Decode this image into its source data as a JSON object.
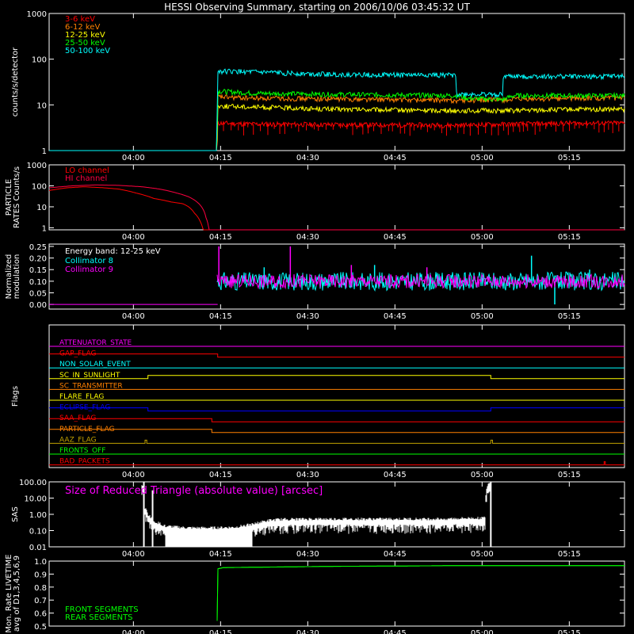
{
  "title": "HESSI Observing Summary, starting on 2006/10/06 03:45:32 UT",
  "time_axis": {
    "start_min": 0,
    "end_min": 99,
    "tick_labels": [
      "04:00",
      "04:15",
      "04:30",
      "04:45",
      "05:00",
      "05:15"
    ],
    "tick_positions_min": [
      14.5,
      29.5,
      44.5,
      59.5,
      74.5,
      89.5
    ]
  },
  "colors": {
    "red": "#ff0000",
    "orange": "#ff8000",
    "yellow": "#ffff00",
    "green": "#00ff00",
    "cyan": "#00ffff",
    "magenta": "#ff00ff",
    "crimson": "#ff0040",
    "blue": "#0000ff",
    "olive": "#c0a000",
    "white": "#ffffff"
  },
  "chart_data": [
    {
      "id": "count-rates",
      "type": "line",
      "ylabel": "counts/s/detector",
      "yscale": "log",
      "ylim": [
        1,
        1000
      ],
      "yticks": [
        "1",
        "10",
        "100",
        "1000"
      ],
      "legend_placement": "top-left",
      "x_units": "minutes after 03:45:32 UT",
      "series": [
        {
          "name": "3-6 keV",
          "color": "red",
          "x": [
            0,
            28.9,
            29,
            35,
            50,
            70,
            80,
            90,
            99
          ],
          "y": [
            1,
            1,
            4,
            3.8,
            3.7,
            3.6,
            3.8,
            4.0,
            4.0
          ]
        },
        {
          "name": "6-12 keV",
          "color": "orange",
          "x": [
            0,
            28.9,
            29,
            35,
            50,
            70,
            80,
            90,
            99
          ],
          "y": [
            1,
            1,
            15,
            14,
            13.5,
            12.5,
            13,
            14,
            14
          ]
        },
        {
          "name": "12-25 keV",
          "color": "yellow",
          "x": [
            0,
            28.9,
            29,
            35,
            50,
            70,
            80,
            90,
            99
          ],
          "y": [
            1,
            1,
            9.5,
            9,
            8,
            7.5,
            7.5,
            8,
            8
          ]
        },
        {
          "name": "25-50 keV",
          "color": "green",
          "x": [
            0,
            28.9,
            29,
            35,
            50,
            70,
            72,
            78,
            80,
            90,
            99
          ],
          "y": [
            1,
            1,
            20,
            18,
            17,
            16,
            14,
            13,
            16,
            16,
            16
          ]
        },
        {
          "name": "50-100 keV",
          "color": "cyan",
          "x": [
            0,
            28.9,
            29,
            40,
            50,
            70,
            70.1,
            78,
            78.1,
            90,
            99
          ],
          "y": [
            1,
            1,
            55,
            50,
            46,
            45,
            17,
            17,
            42,
            42,
            42
          ]
        }
      ]
    },
    {
      "id": "particle-rates",
      "type": "line",
      "ylabel": "PARTICLE RATES Counts/s",
      "yscale": "log",
      "ylim": [
        0.8,
        1000
      ],
      "yticks": [
        "1",
        "10",
        "100",
        "1000"
      ],
      "legend_placement": "top-left",
      "x_units": "minutes after 03:45:32 UT",
      "series": [
        {
          "name": "LO channel",
          "color": "red",
          "x": [
            0,
            3,
            6,
            9,
            12,
            15,
            18,
            21,
            23,
            24,
            25,
            26,
            26.5,
            99
          ],
          "y": [
            60,
            80,
            90,
            82,
            70,
            45,
            25,
            17,
            14,
            10,
            5,
            2,
            0.8,
            0.8
          ]
        },
        {
          "name": "HI channel",
          "color": "crimson",
          "x": [
            0,
            4,
            8,
            12,
            16,
            19,
            22,
            24,
            26,
            27,
            27.5,
            99
          ],
          "y": [
            80,
            100,
            110,
            105,
            90,
            70,
            45,
            30,
            12,
            3,
            0.8,
            0.8
          ]
        }
      ]
    },
    {
      "id": "modulation",
      "type": "line",
      "ylabel": "Normalized modulation",
      "annotation": "Energy band: 12-25 keV",
      "ylim": [
        -0.02,
        0.26
      ],
      "yticks": [
        "0.00",
        "0.05",
        "0.10",
        "0.15",
        "0.20",
        "0.25"
      ],
      "legend_placement": "top-left",
      "x_units": "minutes after 03:45:32 UT",
      "series": [
        {
          "name": "Collimator 8",
          "color": "cyan",
          "x_start": 29,
          "x_end": 99,
          "mean": 0.1,
          "spread": 0.04,
          "spikes": [
            [
              37,
              0.16
            ],
            [
              56,
              0.17
            ],
            [
              83,
              0.21
            ],
            [
              87,
              0.0
            ],
            [
              93,
              0.15
            ]
          ]
        },
        {
          "name": "Collimator 9",
          "color": "magenta",
          "x_start": 29,
          "x_end": 99,
          "mean": 0.1,
          "spread": 0.03,
          "spikes": [
            [
              29.2,
              0.25
            ],
            [
              41.5,
              0.25
            ],
            [
              52,
              0.17
            ],
            [
              65,
              0.16
            ]
          ]
        }
      ]
    },
    {
      "id": "flags",
      "type": "line",
      "ylabel": "Flags",
      "x_units": "minutes after 03:45:32 UT",
      "flags": [
        {
          "name": "ATTENUATOR_STATE",
          "color": "magenta",
          "x": [
            0,
            99
          ],
          "y": [
            0,
            0
          ]
        },
        {
          "name": "GAP_FLAG",
          "color": "red",
          "x": [
            0,
            29,
            29,
            99
          ],
          "y": [
            1,
            1,
            0,
            0
          ]
        },
        {
          "name": "NON_SOLAR_EVENT",
          "color": "cyan",
          "x": [
            0,
            99
          ],
          "y": [
            0,
            0
          ]
        },
        {
          "name": "SC_IN_SUNLIGHT",
          "color": "yellow",
          "x": [
            0,
            17,
            17,
            76,
            76,
            99
          ],
          "y": [
            0,
            0,
            1,
            1,
            0,
            0
          ]
        },
        {
          "name": "SC_TRANSMITTER",
          "color": "orange",
          "x": [
            0,
            99
          ],
          "y": [
            0,
            0
          ]
        },
        {
          "name": "FLARE_FLAG",
          "color": "yellow",
          "x": [
            0,
            99
          ],
          "y": [
            0,
            0
          ]
        },
        {
          "name": "ECLIPSE_FLAG",
          "color": "blue",
          "x": [
            0,
            17,
            17,
            76,
            76,
            99
          ],
          "y": [
            1,
            1,
            0,
            0,
            1,
            1
          ]
        },
        {
          "name": "SAA_FLAG",
          "color": "red",
          "x": [
            0,
            28,
            28,
            99
          ],
          "y": [
            1,
            1,
            0,
            0
          ]
        },
        {
          "name": "PARTICLE_FLAG",
          "color": "orange",
          "x": [
            0,
            28,
            28,
            99
          ],
          "y": [
            1,
            1,
            0,
            0
          ]
        },
        {
          "name": "AAZ_FLAG",
          "color": "olive",
          "x": [
            0,
            16.5,
            16.5,
            16.8,
            16.8,
            76,
            76,
            76.3,
            76.3,
            99
          ],
          "y": [
            0,
            0,
            1,
            1,
            0,
            0,
            1,
            1,
            0,
            0
          ]
        },
        {
          "name": "FRONTS_OFF",
          "color": "green",
          "x": [
            0,
            99
          ],
          "y": [
            0,
            0
          ]
        },
        {
          "name": "BAD_PACKETS",
          "color": "red",
          "x": [
            0,
            95.5,
            95.5,
            95.7,
            95.7,
            99
          ],
          "y": [
            0,
            0,
            1,
            1,
            0,
            0
          ]
        }
      ]
    },
    {
      "id": "sas",
      "type": "line",
      "ylabel": "SAS",
      "annotation": "Size of Reduced Triangle (absolute value) [arcsec]",
      "yscale": "log",
      "ylim": [
        0.01,
        100
      ],
      "yticks": [
        "0.01",
        "0.10",
        "1.00",
        "10.00",
        "100.00"
      ],
      "x_units": "minutes after 03:45:32 UT",
      "series": [
        {
          "name": "",
          "color": "white",
          "x": [
            16,
            16.5,
            17,
            18,
            20,
            24,
            28,
            32,
            35,
            38,
            40,
            45,
            55,
            65,
            70,
            75,
            76,
            76.2
          ],
          "y": [
            60,
            2,
            0.8,
            0.3,
            0.15,
            0.12,
            0.12,
            0.13,
            0.2,
            0.35,
            0.4,
            0.42,
            0.42,
            0.42,
            0.45,
            0.5,
            100,
            0.01
          ],
          "spread": 0.5
        }
      ]
    },
    {
      "id": "livetime",
      "type": "line",
      "ylabel": "Mon. Rate LIVETIME avg of D1,3,4,5,6,9",
      "ylim": [
        0.5,
        1.0
      ],
      "yticks": [
        "0.5",
        "0.6",
        "0.7",
        "0.8",
        "0.9",
        "1.0"
      ],
      "legend_placement": "bottom-left",
      "x_units": "minutes after 03:45:32 UT",
      "series": [
        {
          "name": "FRONT SEGMENTS",
          "color": "green",
          "x": [
            28.9,
            29,
            30,
            40,
            50,
            60,
            70,
            80,
            90,
            99
          ],
          "y": [
            0.5,
            0.94,
            0.95,
            0.955,
            0.96,
            0.962,
            0.965,
            0.965,
            0.965,
            0.965
          ]
        },
        {
          "name": "REAR SEGMENTS",
          "color": "green",
          "x": [
            28.9,
            29,
            30,
            40,
            50,
            60,
            70,
            80,
            90,
            99
          ],
          "y": [
            0.5,
            0.94,
            0.95,
            0.955,
            0.96,
            0.962,
            0.965,
            0.965,
            0.965,
            0.965
          ]
        }
      ]
    }
  ]
}
